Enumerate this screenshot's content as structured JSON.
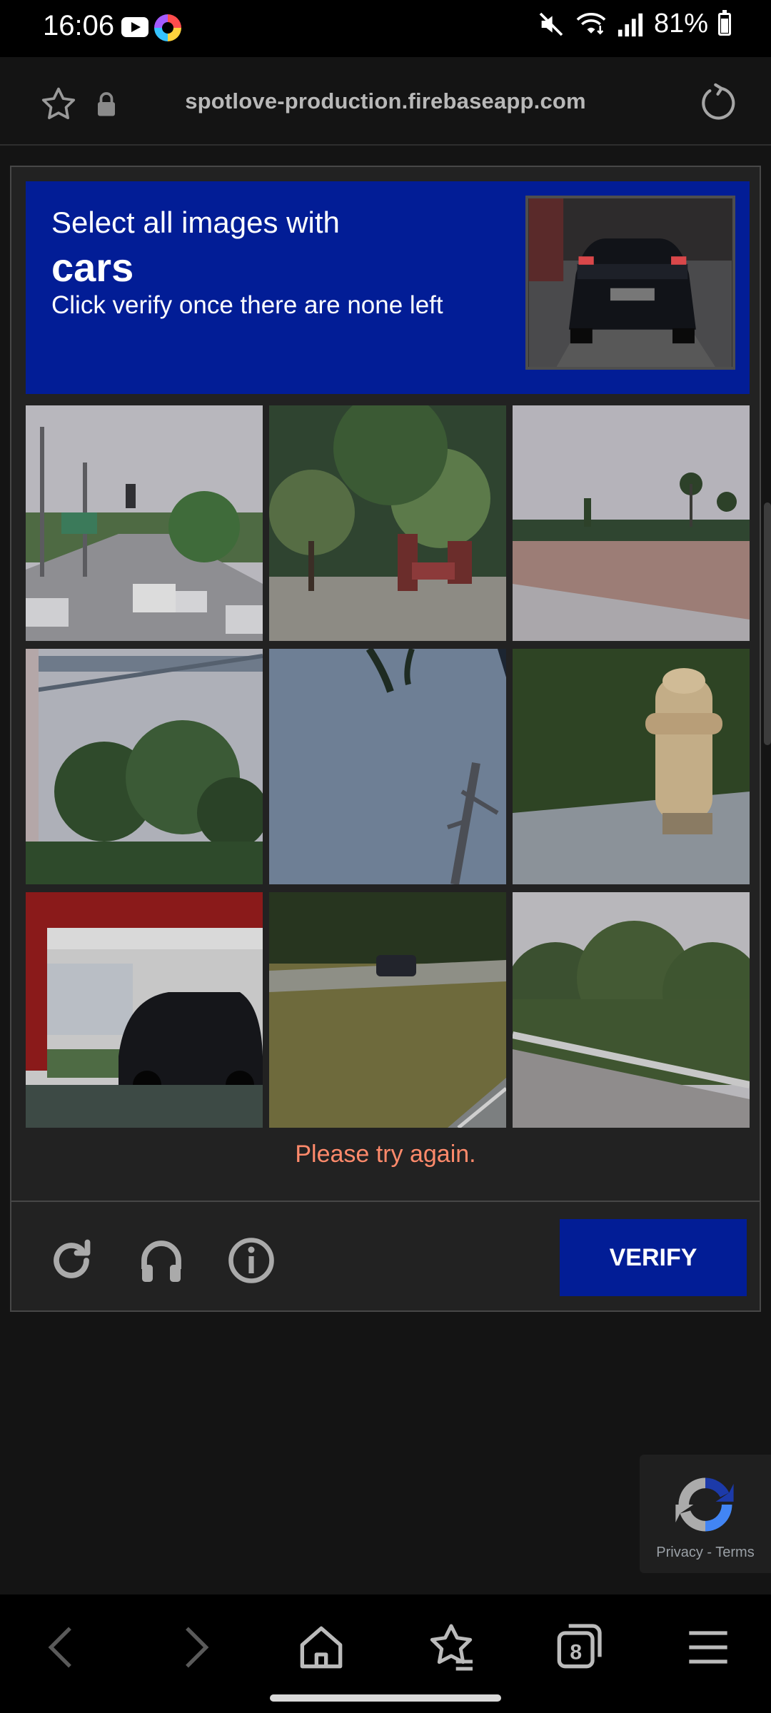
{
  "status_bar": {
    "time": "16:06",
    "battery": "81%",
    "icons": [
      "youtube-icon",
      "app-icon",
      "mute-icon",
      "wifi-icon",
      "signal-icon",
      "battery-icon"
    ]
  },
  "browser": {
    "url": "spotlove-production.firebaseapp.com",
    "icons": [
      "star-icon",
      "lock-icon",
      "reload-icon"
    ]
  },
  "captcha": {
    "instruction": "Select all images with",
    "target": "cars",
    "hint": "Click verify once there are none left",
    "error": "Please try again.",
    "verify_label": "VERIFY",
    "accent": "#021d96",
    "error_color": "#ff8a6b",
    "tiles": [
      "street-with-cars",
      "trees-sidewalk",
      "roadside-palms",
      "overpass-trees",
      "sky-palm-pole",
      "fire-hydrant-grass",
      "parked-car",
      "car-on-road",
      "roadside-bushes"
    ],
    "tool_icons": [
      "refresh-icon",
      "headphones-icon",
      "info-icon"
    ]
  },
  "recaptcha_badge": {
    "privacy": "Privacy",
    "separator": " - ",
    "terms": "Terms"
  },
  "bottom_nav": {
    "tab_count": "8",
    "icons": [
      "back-icon",
      "forward-icon",
      "home-icon",
      "bookmarks-icon",
      "tabs-icon",
      "menu-icon"
    ]
  }
}
